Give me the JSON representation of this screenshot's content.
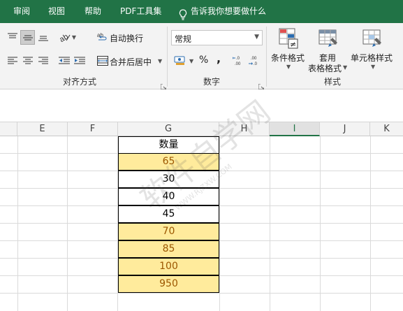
{
  "menu": {
    "items": [
      "审阅",
      "视图",
      "帮助",
      "PDF工具集"
    ],
    "tell_me": "告诉我你想要做什么"
  },
  "ribbon": {
    "alignment": {
      "wrap_text": "自动换行",
      "merge_center": "合并后居中",
      "group_label": "对齐方式"
    },
    "number": {
      "format_value": "常规",
      "percent": "%",
      "comma": ",",
      "group_label": "数字"
    },
    "styles": {
      "conditional_line1": "条件格式",
      "table_line1": "套用",
      "table_line2": "表格格式",
      "cell_styles": "单元格样式",
      "group_label": "样式"
    }
  },
  "grid": {
    "columns": [
      "E",
      "F",
      "G",
      "H",
      "I",
      "J",
      "K"
    ],
    "active_column": "I",
    "header_cell": "数量",
    "rows": [
      {
        "value": "65",
        "highlight": true
      },
      {
        "value": "30",
        "highlight": false
      },
      {
        "value": "40",
        "highlight": false
      },
      {
        "value": "45",
        "highlight": false
      },
      {
        "value": "70",
        "highlight": true
      },
      {
        "value": "85",
        "highlight": true
      },
      {
        "value": "100",
        "highlight": true
      },
      {
        "value": "950",
        "highlight": true
      }
    ],
    "highlight_fill": "#ffeb9c",
    "highlight_text": "#9c5700"
  },
  "watermark": {
    "text": "软件自学网",
    "url": "WWW.RJZXW.COM"
  },
  "colors": {
    "menu_bg": "#217346",
    "ribbon_bg": "#f3f3f3"
  }
}
